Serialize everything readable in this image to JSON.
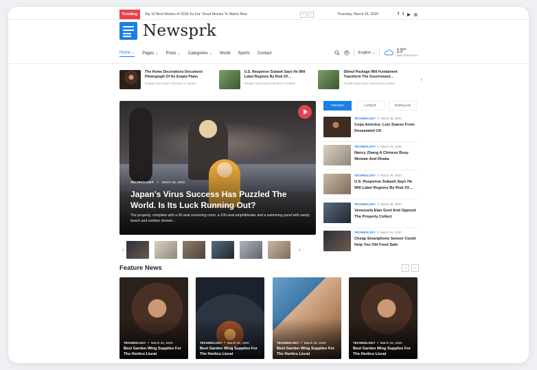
{
  "topbar": {
    "trending_label": "Trending",
    "trending_text": "Top 10 Best Movies of 2018 So Far: Great Movies To Watch Now",
    "date": "Thursday, March 26, 2020",
    "prev": "‹",
    "next": "›",
    "social": [
      "f",
      "t",
      "▶",
      "◎"
    ]
  },
  "logo": {
    "name": "Newsprk"
  },
  "nav": {
    "items": [
      {
        "label": "Home",
        "dropdown": true,
        "active": true
      },
      {
        "label": "Pages",
        "dropdown": true
      },
      {
        "label": "Posts",
        "dropdown": true
      },
      {
        "label": "Categories",
        "dropdown": true
      },
      {
        "label": "World"
      },
      {
        "label": "Sports"
      },
      {
        "label": "Contact"
      }
    ],
    "language": "English",
    "temperature": "13",
    "temp_unit": "0C",
    "city": "San Francisco"
  },
  "ticker": [
    {
      "title": "The Home Decorations Document: Photograph Of An Empty Plane",
      "sub": "People have been infected in United"
    },
    {
      "title": "U.S. Response Subash Says He Will Label Regions By Risk Of…",
      "sub": "People have been infected in United"
    },
    {
      "title": "Stimul Package Will Fundament Transform The Government…",
      "sub": "People have been infected in United"
    }
  ],
  "hero": {
    "category": "TECHNOLOGY",
    "date": "March 26, 2020",
    "title": "Japan’s Virus Success Has Puzzled The World. Is Its Luck Running Out?",
    "excerpt": "The property, complete with a 30-seat screening room, a 100-seat amphitheater and a swimming pond with sandy beach and outdoor shower…"
  },
  "tabs": [
    "TRENDY",
    "LATEST",
    "POPULAR"
  ],
  "side_news": [
    {
      "category": "TECHNOLOGY",
      "date": "March 26, 2020",
      "title": "Copa America: Luis Suarez From Devastated US"
    },
    {
      "category": "TECHNOLOGY",
      "date": "March 26, 2020",
      "title": "Nancy Zhang A Chinese Busy Woman And Dhaka"
    },
    {
      "category": "TECHNOLOGY",
      "date": "March 26, 2020",
      "title": "U.S. Response Subash Says He Will Label Regions By Risk Of…"
    },
    {
      "category": "TECHNOLOGY",
      "date": "March 26, 2020",
      "title": "Venezuela Elan Govt And Opposit The Property Collect"
    },
    {
      "category": "TECHNOLOGY",
      "date": "March 26, 2020",
      "title": "Cheap Smartphone Sensor Could Help You Old Food Safe"
    }
  ],
  "feature": {
    "title": "Feature News",
    "cards": [
      {
        "category": "TECHNOLOGY",
        "date": "March 26, 2020",
        "title": "Best Garden Wing Supplies For The Horticu Ltural"
      },
      {
        "category": "TECHNOLOGY",
        "date": "March 26, 2020",
        "title": "Best Garden Wing Supplies For The Horticu Ltural"
      },
      {
        "category": "TECHNOLOGY",
        "date": "March 26, 2020",
        "title": "Best Garden Wing Supplies For The Horticu Ltural"
      },
      {
        "category": "TECHNOLOGY",
        "date": "March 26, 2020",
        "title": "Best Garden Wing Supplies For The Horticu Ltural"
      }
    ]
  },
  "colors": {
    "accent": "#1a80e5",
    "trending": "#e8434b"
  }
}
